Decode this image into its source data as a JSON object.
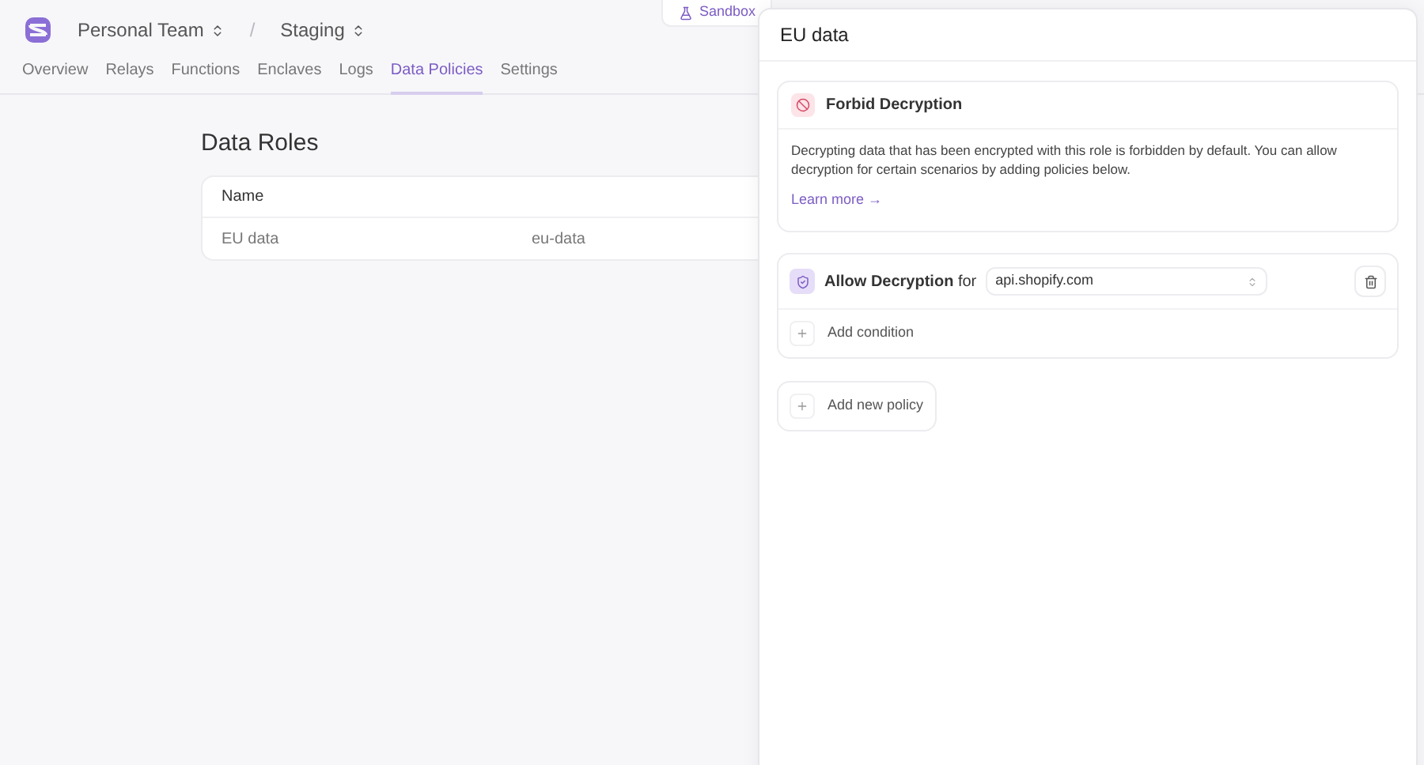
{
  "header": {
    "team": "Personal Team",
    "separator": "/",
    "environment": "Staging",
    "sandbox_label": "Sandbox"
  },
  "nav": [
    {
      "label": "Overview",
      "selected": false
    },
    {
      "label": "Relays",
      "selected": false
    },
    {
      "label": "Functions",
      "selected": false
    },
    {
      "label": "Enclaves",
      "selected": false
    },
    {
      "label": "Logs",
      "selected": false
    },
    {
      "label": "Data Policies",
      "selected": true
    },
    {
      "label": "Settings",
      "selected": false
    }
  ],
  "page_title": "Data Roles",
  "table": {
    "columns": [
      "Name"
    ],
    "rows": [
      [
        "EU data",
        "eu-data"
      ]
    ]
  },
  "panel": {
    "title": "EU data",
    "forbid": {
      "title": "Forbid Decryption",
      "text": "Decrypting data that has been encrypted with this role is forbidden by default. You can allow decryption for certain scenarios by adding policies below.",
      "link": "Learn more →"
    },
    "policies": [
      {
        "label": "**Allow Decryption** for",
        "target": "api.shopify.com",
        "add_condition": "Add condition"
      }
    ],
    "add_policy": "Add new policy"
  }
}
